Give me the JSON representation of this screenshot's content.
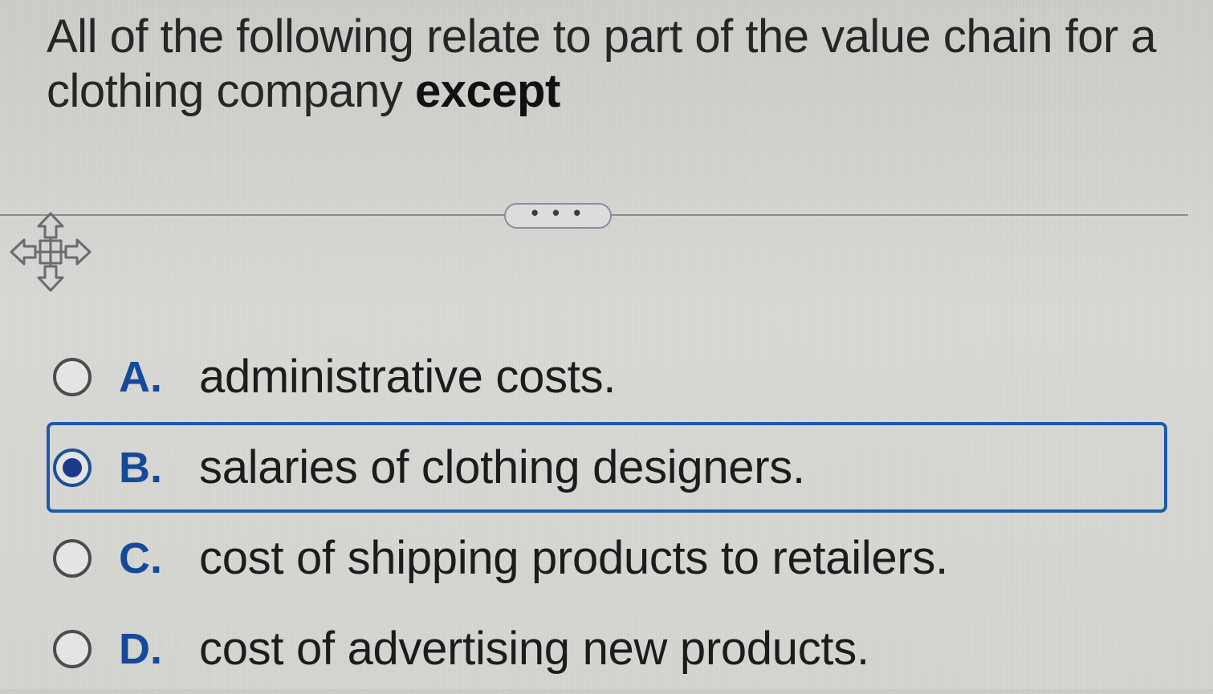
{
  "question": {
    "text": "All of the following relate to part of the value chain for a clothing company ",
    "emphasis": "except"
  },
  "toolbar": {
    "more_label": "• • •",
    "move_icon": "move-arrows-icon"
  },
  "options": [
    {
      "letter": "A.",
      "text": "administrative costs.",
      "selected": false
    },
    {
      "letter": "B.",
      "text": "salaries of clothing designers.",
      "selected": true
    },
    {
      "letter": "C.",
      "text": "cost of shipping products to retailers.",
      "selected": false
    },
    {
      "letter": "D.",
      "text": "cost of advertising new products.",
      "selected": false
    }
  ],
  "colors": {
    "accent": "#1f5aa8",
    "letter": "#17499a"
  }
}
